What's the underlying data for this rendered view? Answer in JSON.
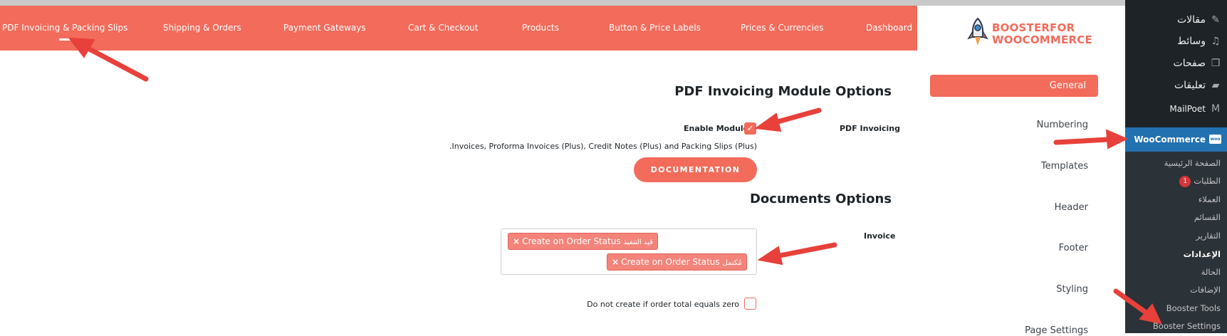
{
  "top_nav": {
    "items": [
      {
        "label": "PDF Invoicing & Packing Slips",
        "active": true
      },
      {
        "label": "Shipping & Orders"
      },
      {
        "label": "Payment Gateways"
      },
      {
        "label": "Cart & Checkout"
      },
      {
        "label": "Products"
      },
      {
        "label": "Button & Price Labels"
      },
      {
        "label": "Prices & Currencies"
      },
      {
        "label": "Dashboard"
      }
    ]
  },
  "logo": {
    "line1": "BOOSTERFOR",
    "line2": "WOOCOMMERCE"
  },
  "wp_admin": {
    "top_items": [
      {
        "label": "مقالات",
        "icon": "pin-icon"
      },
      {
        "label": "وسائط",
        "icon": "media-icon"
      },
      {
        "label": "صفحات",
        "icon": "pages-icon"
      },
      {
        "label": "تعليقات",
        "icon": "comments-icon"
      },
      {
        "label": "MailPoet",
        "icon": "mailpoet-icon"
      }
    ],
    "woocommerce": {
      "label": "WooCommerce",
      "icon_text": "woo"
    },
    "sub_items": [
      {
        "label": "الصفحة الرئيسية"
      },
      {
        "label": "الطلبات",
        "badge": "1"
      },
      {
        "label": "العملاء"
      },
      {
        "label": "القسائم"
      },
      {
        "label": "التقارير"
      },
      {
        "label": "الإعدادات",
        "bold": true
      },
      {
        "label": "الحالة"
      },
      {
        "label": "الإضافات"
      },
      {
        "label": "Booster Tools"
      },
      {
        "label": "Booster Settings"
      }
    ]
  },
  "side_menu": {
    "active": "General",
    "items": [
      "Numbering",
      "Templates",
      "Header",
      "Footer",
      "Styling",
      "Page Settings"
    ]
  },
  "content": {
    "module_title": "PDF Invoicing Module Options",
    "pdf_invoicing_label": "PDF Invoicing",
    "enable_module_label": "Enable Module",
    "enable_module_checked": true,
    "description": ".Invoices, Proforma Invoices (Plus), Credit Notes (Plus) and Packing Slips (Plus)",
    "documentation_button": "DOCUMENTATION",
    "documents_title": "Documents Options",
    "invoice_label": "Invoice",
    "status_tags": [
      {
        "text": "Create on Order Status",
        "arabic": "قيد التنفيذ",
        "remove": "×"
      },
      {
        "text": "Create on Order Status",
        "arabic": "مُكتمل",
        "remove": "×"
      }
    ],
    "zero_total_label": "Do not create if order total equals zero",
    "zero_total_checked": false
  },
  "colors": {
    "accent": "#f26b5b",
    "wp_dark": "#1d2327",
    "wp_blue": "#2271b1",
    "arrow": "#e8403a"
  }
}
